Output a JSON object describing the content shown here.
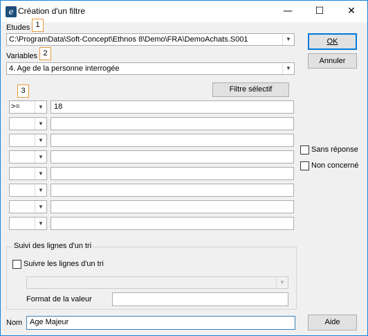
{
  "window": {
    "title": "Création d'un filtre",
    "app_icon": "e",
    "minimize_icon": "—",
    "maximize_icon": "☐",
    "close_icon": "✕"
  },
  "etudes": {
    "label": "Etudes",
    "marker": "1",
    "value": "C:\\ProgramData\\Soft-Concept\\Ethnos 8\\Demo\\FRA\\DemoAchats.S001"
  },
  "variables": {
    "label": "Variables",
    "marker": "2",
    "value": "4. Age de la personne interrogée"
  },
  "conditions": {
    "marker": "3",
    "filter_button": "Filtre sélectif",
    "rows": [
      {
        "operator": ">=",
        "value": "18"
      },
      {
        "operator": "",
        "value": ""
      },
      {
        "operator": "",
        "value": ""
      },
      {
        "operator": "",
        "value": ""
      },
      {
        "operator": "",
        "value": ""
      },
      {
        "operator": "",
        "value": ""
      },
      {
        "operator": "",
        "value": ""
      },
      {
        "operator": "",
        "value": ""
      }
    ]
  },
  "options": {
    "sans_reponse": "Sans réponse",
    "non_concerne": "Non concerné"
  },
  "buttons": {
    "ok": "OK",
    "annuler": "Annuler",
    "aide": "Aide"
  },
  "suivi": {
    "group_title": "Suivi des lignes d'un tri",
    "checkbox_label": "Suivre les lignes d'un tri",
    "select_value": "",
    "format_label": "Format de la valeur",
    "format_value": ""
  },
  "nom": {
    "label": "Nom",
    "value": "Age Majeur"
  },
  "arrow_glyph": "▼"
}
